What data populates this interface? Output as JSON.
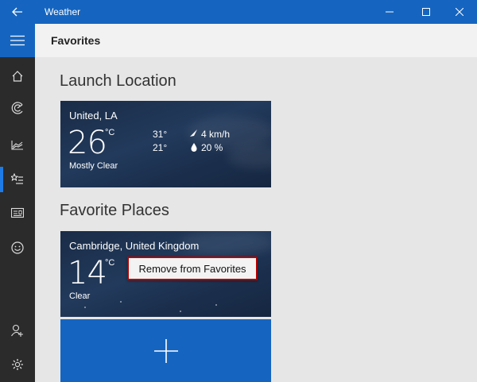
{
  "window": {
    "title": "Weather",
    "back_icon": "back-arrow-icon",
    "controls": [
      "minimize-icon",
      "maximize-icon",
      "close-icon"
    ]
  },
  "sidebar": {
    "items": [
      {
        "name": "hamburger-menu",
        "icon": "hamburger-icon"
      },
      {
        "name": "forecast",
        "icon": "home-icon"
      },
      {
        "name": "maps",
        "icon": "radar-icon"
      },
      {
        "name": "historical-weather",
        "icon": "chart-icon"
      },
      {
        "name": "favorites",
        "icon": "star-list-icon",
        "active": true
      },
      {
        "name": "news",
        "icon": "news-icon"
      },
      {
        "name": "feedback",
        "icon": "smiley-icon"
      },
      {
        "name": "account",
        "icon": "add-user-icon"
      },
      {
        "name": "settings",
        "icon": "gear-icon"
      }
    ]
  },
  "header": {
    "title": "Favorites"
  },
  "launch": {
    "section_title": "Launch Location",
    "card": {
      "location": "United, LA",
      "temp": "26",
      "unit": "°C",
      "condition": "Mostly Clear",
      "high": "31°",
      "low": "21°",
      "wind": "4 km/h",
      "humidity": "20 %"
    }
  },
  "favorites": {
    "section_title": "Favorite Places",
    "card": {
      "location": "Cambridge, United Kingdom",
      "temp": "14",
      "unit": "°C",
      "condition": "Clear"
    },
    "add_icon": "plus-icon"
  },
  "context_menu": {
    "item": "Remove from Favorites"
  },
  "colors": {
    "accent": "#1565c0",
    "sidebar": "#2b2b2b",
    "highlight_border": "#b00000"
  }
}
